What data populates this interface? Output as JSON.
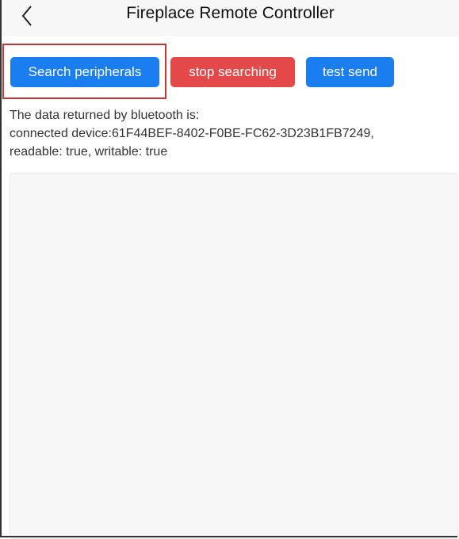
{
  "header": {
    "title": "Fireplace Remote Controller",
    "back_icon": "chevron-left-icon"
  },
  "toolbar": {
    "search_label": "Search peripherals",
    "stop_label": "stop searching",
    "test_label": "test send"
  },
  "colors": {
    "primary": "#1a7ef0",
    "danger": "#e54848",
    "highlight_border": "#cc3333"
  },
  "info": {
    "heading": "The data returned by bluetooth is:",
    "line1": "connected device:61F44BEF-8402-F0BE-FC62-3D23B1FB7249,",
    "line2": "readable: true, writable: true"
  }
}
